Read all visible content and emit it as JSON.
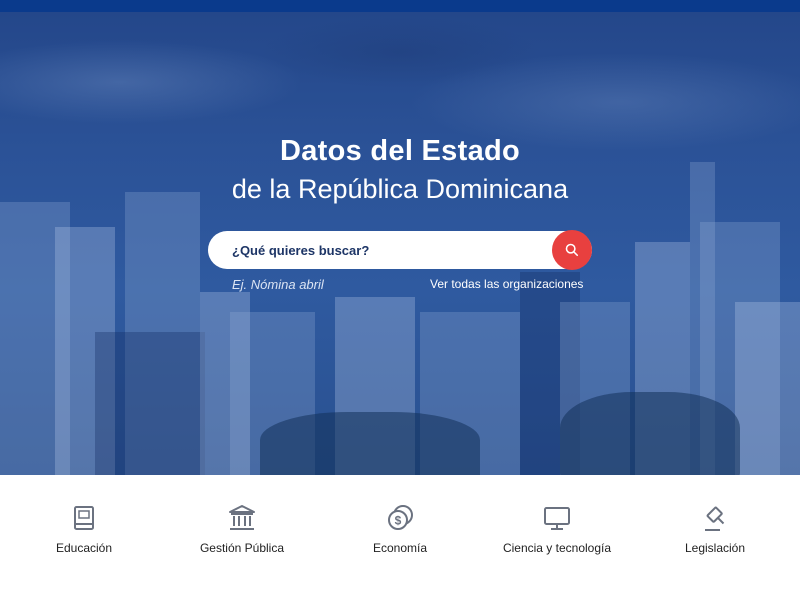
{
  "hero": {
    "title": "Datos del Estado",
    "subtitle": "de la República Dominicana"
  },
  "search": {
    "placeholder": "¿Qué quieres buscar?",
    "hint": "Ej. Nómina abril",
    "button_icon": "search-icon"
  },
  "links": {
    "organizations": "Ver todas las organizaciones"
  },
  "categories": [
    {
      "label": "Educación",
      "icon": "book-icon"
    },
    {
      "label": "Gestión Pública",
      "icon": "bank-icon"
    },
    {
      "label": "Economía",
      "icon": "coins-icon"
    },
    {
      "label": "Ciencia y tecnología",
      "icon": "monitor-icon"
    },
    {
      "label": "Legislación",
      "icon": "gavel-icon"
    }
  ],
  "colors": {
    "topbar": "#0a3a8c",
    "hero_overlay": "#2b5297",
    "search_button": "#e8403f",
    "icon_gray": "#6b7280"
  }
}
